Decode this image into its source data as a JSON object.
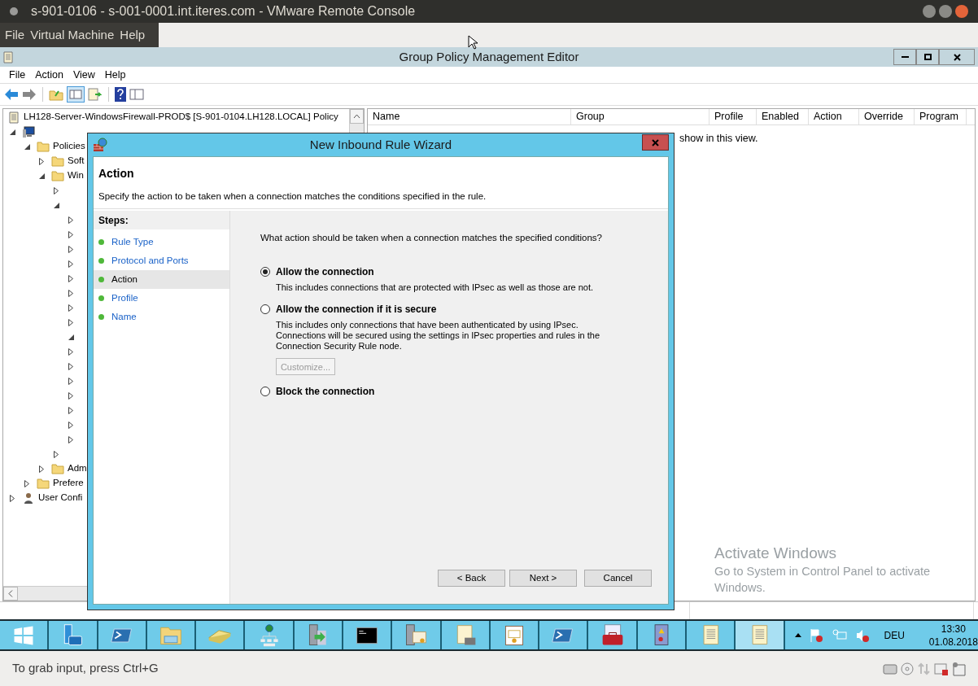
{
  "vmware": {
    "title": "s-901-0106 - s-001-0001.int.iteres.com - VMware Remote Console",
    "menu": [
      "File",
      "Virtual Machine",
      "Help"
    ],
    "status": "To grab input, press Ctrl+G"
  },
  "editor": {
    "title": "Group Policy Management Editor",
    "menu": [
      "File",
      "Action",
      "View",
      "Help"
    ],
    "tree": [
      {
        "label": "LH128-Server-WindowsFirewall-PROD$ [S-901-0104.LH128.LOCAL] Policy",
        "kind": "policy",
        "children": [
          {
            "kind": "computer",
            "expanded": true,
            "children": [
              {
                "label": "Policies",
                "kind": "folder",
                "expanded": true,
                "children": [
                  {
                    "label": "Soft",
                    "kind": "folder",
                    "expanded": false
                  },
                  {
                    "label": "Win",
                    "kind": "folder",
                    "expanded": true,
                    "children": [
                      {
                        "expanded": false
                      },
                      {
                        "expanded": true,
                        "children": [
                          {
                            "expanded": false
                          },
                          {
                            "expanded": false
                          },
                          {
                            "expanded": false
                          },
                          {
                            "expanded": false
                          },
                          {
                            "expanded": false
                          },
                          {
                            "expanded": false
                          },
                          {
                            "expanded": false
                          },
                          {
                            "expanded": false
                          },
                          {
                            "expanded": true
                          },
                          {
                            "expanded": false
                          },
                          {
                            "expanded": false
                          },
                          {
                            "expanded": false
                          },
                          {
                            "expanded": false
                          },
                          {
                            "expanded": false
                          },
                          {
                            "expanded": false
                          },
                          {
                            "expanded": false
                          }
                        ]
                      },
                      {
                        "expanded": false
                      }
                    ]
                  },
                  {
                    "label": "Adm",
                    "kind": "folder",
                    "expanded": false
                  }
                ]
              },
              {
                "label": "Prefere",
                "kind": "folder",
                "expanded": false
              }
            ]
          },
          {
            "label": "User Confi",
            "kind": "user",
            "expanded": false
          }
        ]
      }
    ],
    "columns": [
      "Name",
      "Group",
      "Profile",
      "Enabled",
      "Action",
      "Override",
      "Program"
    ],
    "empty_message": "show in this view."
  },
  "wizard": {
    "title": "New Inbound Rule Wizard",
    "heading": "Action",
    "subheading": "Specify the action to be taken when a connection matches the conditions specified in the rule.",
    "steps_title": "Steps:",
    "steps": [
      {
        "label": "Rule Type",
        "selected": false
      },
      {
        "label": "Protocol and Ports",
        "selected": false
      },
      {
        "label": "Action",
        "selected": true
      },
      {
        "label": "Profile",
        "selected": false
      },
      {
        "label": "Name",
        "selected": false
      }
    ],
    "question": "What action should be taken when a connection matches the specified conditions?",
    "options": [
      {
        "label": "Allow the connection",
        "description": "This includes connections that are protected with IPsec as well as those are not.",
        "selected": true
      },
      {
        "label": "Allow the connection if it is secure",
        "description": "This includes only connections that have been authenticated by using IPsec.  Connections will be secured using the settings in IPsec properties and rules in the Connection Security Rule node.",
        "selected": false,
        "button": {
          "label": "Customize...",
          "disabled": true
        }
      },
      {
        "label": "Block the connection",
        "selected": false
      }
    ],
    "buttons": [
      "< Back",
      "Next >",
      "Cancel"
    ]
  },
  "activation": {
    "title": "Activate Windows",
    "message": "Go to System in Control Panel to activate Windows."
  },
  "taskbar": {
    "items": [
      {
        "kind": "windows",
        "selected": false
      },
      {
        "kind": "server",
        "selected": false
      },
      {
        "kind": "powershell",
        "selected": false
      },
      {
        "kind": "folder",
        "selected": false
      },
      {
        "kind": "scanner",
        "selected": false
      },
      {
        "kind": "network",
        "selected": false
      },
      {
        "kind": "server-arrow",
        "selected": false
      },
      {
        "kind": "terminal",
        "selected": false
      },
      {
        "kind": "server-cert",
        "selected": false
      },
      {
        "kind": "scroll-tools",
        "selected": false
      },
      {
        "kind": "certificate",
        "selected": false
      },
      {
        "kind": "powershell",
        "selected": false
      },
      {
        "kind": "toolbox",
        "selected": false
      },
      {
        "kind": "book-warning",
        "selected": false
      },
      {
        "kind": "scroll",
        "selected": false
      },
      {
        "kind": "scroll",
        "selected": true
      }
    ],
    "tray": {
      "language": "DEU",
      "time": "13:30",
      "date": "01.08.2018"
    }
  }
}
